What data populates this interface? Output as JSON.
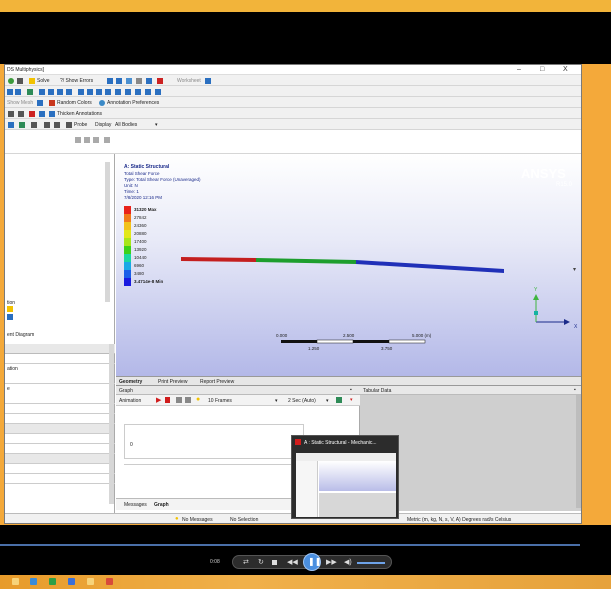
{
  "window": {
    "title": "DS Multiphysics]",
    "minimize": "–",
    "maximize": "□",
    "close": "X"
  },
  "toolbar1": {
    "solve": "Solve",
    "show_errors": "?/ Show Errors",
    "worksheet": "Worksheet"
  },
  "toolbar2": {
    "items": [
      "Show Mesh",
      "Random Colors",
      "Annotation Preferences"
    ]
  },
  "toolbar3": {
    "thicken": "Thicken Annotations"
  },
  "toolbar4": {
    "probe": "Probe",
    "display_label": "Display",
    "display_value": "All Bodies"
  },
  "tree_pane": {
    "items": [
      "tion",
      "ent Diagram"
    ]
  },
  "details_pane": {
    "header": "ation",
    "row1": "e"
  },
  "result": {
    "header": "A: Static Structural",
    "lines": [
      "Total Shear Force",
      "Type: Total Shear Force (Unaveraged)",
      "Unit: N",
      "Time: 1",
      "7/8/2020 12:16 PM"
    ]
  },
  "legend": {
    "entries": [
      "31320 Max",
      "27842",
      "24360",
      "20880",
      "17400",
      "13920",
      "10440",
      "6960",
      "3480",
      "3.4714e-8 Min"
    ],
    "colors": [
      "#e8221a",
      "#f07a1a",
      "#f2c21a",
      "#e2e81a",
      "#a8e61a",
      "#3cd21a",
      "#1ad8a0",
      "#1aa8e6",
      "#1a5ee8",
      "#1a1ae0"
    ]
  },
  "brand": {
    "name": "ANSYS",
    "version": "R15.0"
  },
  "beam_colors": {
    "red": "#c41f1f",
    "green": "#1d9e2d",
    "blue": "#2030b8"
  },
  "scale": {
    "ticks_top": [
      "0.000",
      "2.500",
      "5.000 (m)"
    ],
    "ticks_bottom": [
      "1.250",
      "3.750"
    ]
  },
  "triad": {
    "x": "X",
    "y": "Y"
  },
  "graph_tabs": {
    "items": [
      "Geometry",
      "Print Preview",
      "Report Preview"
    ]
  },
  "graph": {
    "title": "Graph",
    "animation": "Animation",
    "frames": "10 Frames",
    "speed": "2 Sec (Auto)",
    "zero": "0",
    "messages_tab": "Messages",
    "graph_tab": "Graph"
  },
  "tabular": {
    "title": "Tabular Data"
  },
  "thumbnail": {
    "title": "A : Static Structural - Mechanic..."
  },
  "status": {
    "no_messages": "No Messages",
    "no_selection": "No Selection",
    "units": "Metric (m, kg, N, s, V, A)  Degrees  rad/s  Celsius"
  },
  "player": {
    "time": "0:08",
    "play_symbol": "❚❚"
  }
}
